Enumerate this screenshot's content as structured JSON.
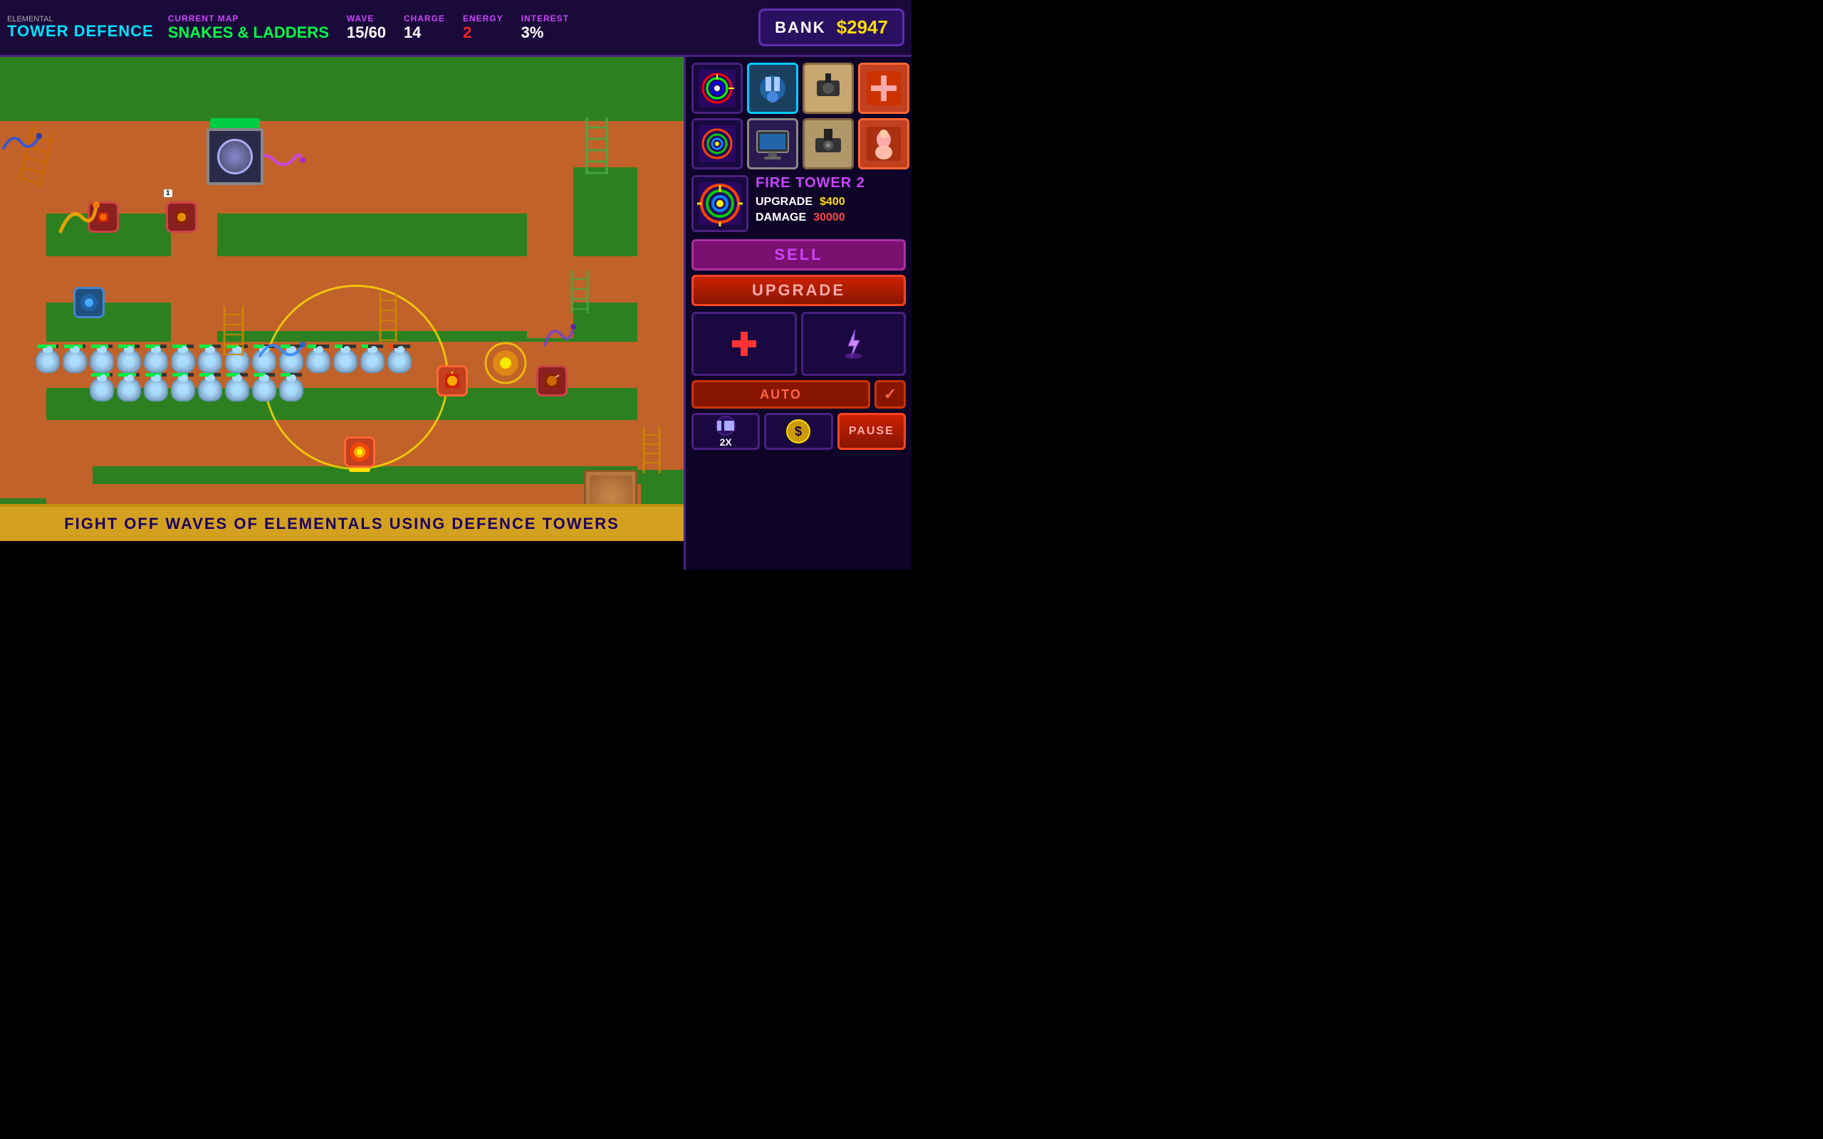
{
  "header": {
    "logo_small": "ELEMENTAL",
    "logo_big1": "TOWER",
    "logo_big2": "DEFENCE",
    "current_map_label": "CURRENT MAP",
    "map_name": "SNAKES & LADDERS",
    "wave_label": "WAVE",
    "wave_value": "15/60",
    "charge_label": "CHARGE",
    "charge_value": "14",
    "energy_label": "ENERGY",
    "energy_value": "2",
    "interest_label": "INTEREST",
    "interest_value": "3%",
    "bank_label": "BANK",
    "bank_value": "$2947"
  },
  "tower_detail": {
    "name": "FIRE TOWER 2",
    "upgrade_label": "UPGRADE",
    "upgrade_cost": "$400",
    "damage_label": "DAMAGE",
    "damage_value": "30000",
    "sell_label": "SELL",
    "upgrade_btn_label": "UPGRADE",
    "auto_label": "AUTO",
    "auto_check": "✓",
    "pause_label": "PAUSE",
    "speed_label": "2X"
  },
  "bottom_bar": {
    "message": "FIGHT OFF WAVES OF ELEMENTALS USING DEFENCE TOWERS"
  },
  "icons": {
    "fire": "🔥",
    "dollar": "$",
    "check": "✓",
    "cross": "+"
  }
}
